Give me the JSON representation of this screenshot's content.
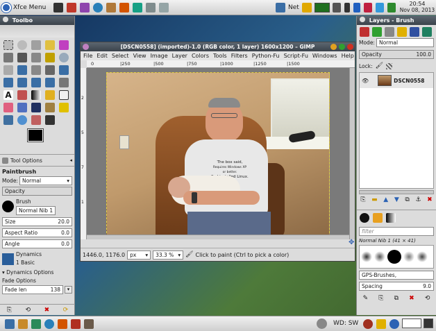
{
  "panel": {
    "menu_label": "Xfce Menu",
    "net_label": "Net",
    "clock_time": "20:54",
    "clock_date": "Nov 08, 2013"
  },
  "toolbox": {
    "title": "Toolbo",
    "tab_tool_options": "Tool Options",
    "tool_name": "Paintbrush",
    "mode_label": "Mode:",
    "mode_value": "Normal",
    "opacity_label": "Opacity",
    "brush_label": "Brush",
    "brush_value": "Normal Nib 1",
    "size_label": "Size",
    "size_value": "20.0",
    "aspect_label": "Aspect Ratio",
    "aspect_value": "0.0",
    "angle_label": "Angle",
    "angle_value": "0.0",
    "dynamics_label": "Dynamics",
    "dynamics_value": "1 Basic",
    "dynamics_options": "Dynamics Options",
    "fade_options": "Fade Options",
    "fade_len_label": "Fade len",
    "fade_len_value": "138"
  },
  "gimp": {
    "title": "[DSCN0558] (imported)-1.0 (RGB color, 1 layer) 1600x1200 – GIMP",
    "menu": [
      "File",
      "Edit",
      "Select",
      "View",
      "Image",
      "Layer",
      "Colors",
      "Tools",
      "Filters",
      "Python-Fu",
      "Script-Fu",
      "Windows",
      "Help"
    ],
    "ruler_ticks": [
      "0",
      "|250",
      "|500",
      "|750",
      "|1000",
      "|1250",
      "|1500"
    ],
    "vruler_ticks": [
      "2",
      "5",
      "7",
      "1"
    ],
    "coords": "1446.0, 1176.0",
    "unit": "px",
    "zoom": "33.3 %",
    "status": "Click to paint (Ctrl to pick a color)",
    "shirt_line1": "The box said,",
    "shirt_line2": "Requires Windows XP",
    "shirt_line3": "or better.",
    "shirt_line4": "So I installed Linux."
  },
  "layers": {
    "title": "Layers - Brush",
    "mode_label": "Mode:",
    "mode_value": "Normal",
    "opacity_label": "Opacity",
    "opacity_value": "100.0",
    "lock_label": "Lock:",
    "layer_name": "DSCN0558",
    "filter_placeholder": "filter",
    "brush_caption": "Normal Nib 1 (41 × 41)",
    "brush_set": "GPS-Brushes,",
    "spacing_label": "Spacing",
    "spacing_value": "9.0"
  },
  "bottom": {
    "wd_label": "WD: SW"
  },
  "colors": {
    "panel_bg": "#dcdcdc",
    "gimp_title_bg": "#3b434b",
    "canvas_bg": "#7a7a7a",
    "photo_wall": "#c2a27a",
    "chair": "#8b5a2b",
    "shirt": "#e8e8e8",
    "layer_selected": "#ffffff"
  }
}
